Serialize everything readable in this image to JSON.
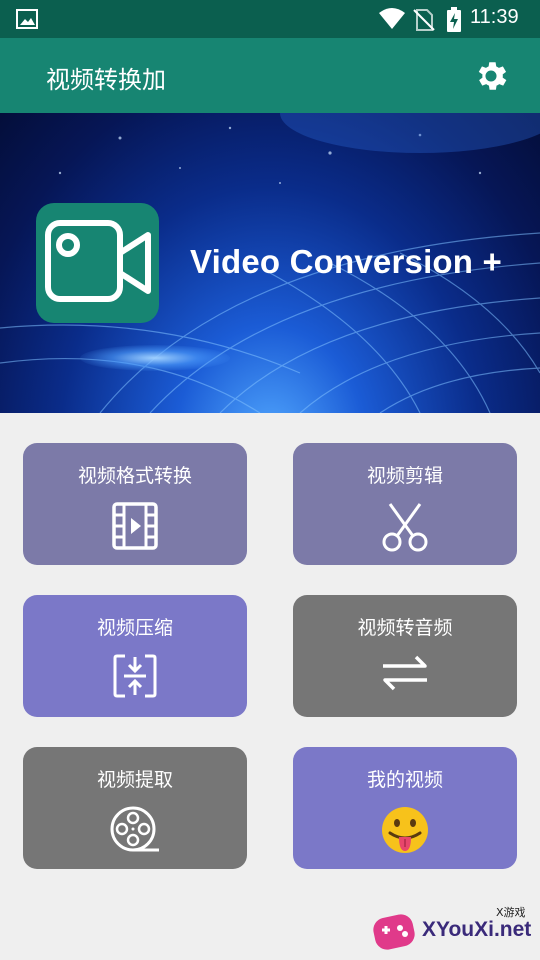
{
  "status_bar": {
    "time": "11:39"
  },
  "app_bar": {
    "title": "视频转换加"
  },
  "banner": {
    "text": "Video Conversion +"
  },
  "tiles": [
    {
      "label": "视频格式转换",
      "icon": "film-play-icon",
      "color": "#7c7aa8"
    },
    {
      "label": "视频剪辑",
      "icon": "scissors-icon",
      "color": "#7c7aa8"
    },
    {
      "label": "视频压缩",
      "icon": "compress-icon",
      "color": "#7b78c8"
    },
    {
      "label": "视频转音频",
      "icon": "swap-arrows-icon",
      "color": "#767676"
    },
    {
      "label": "视频提取",
      "icon": "film-reel-icon",
      "color": "#767676"
    },
    {
      "label": "我的视频",
      "icon": "tongue-emoji-icon",
      "color": "#7b78c8"
    }
  ],
  "watermark": {
    "main": "XYouXi.net",
    "small": "X游戏"
  },
  "colors": {
    "status_bar": "#0b5f4f",
    "app_bar": "#178572",
    "background": "#efefef"
  }
}
